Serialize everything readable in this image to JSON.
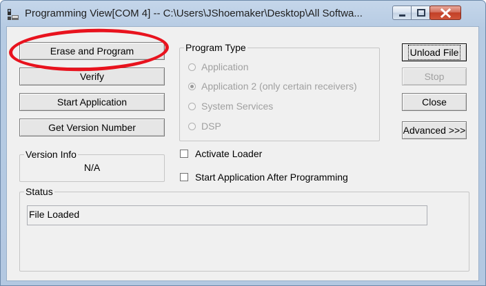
{
  "window": {
    "title": "Programming View[COM 4] -- C:\\Users\\JShoemaker\\Desktop\\All Softwa..."
  },
  "left_buttons": {
    "erase_program": "Erase and Program",
    "verify": "Verify",
    "start_application": "Start Application",
    "get_version": "Get Version Number"
  },
  "program_type": {
    "title": "Program Type",
    "options": [
      "Application",
      "Application 2 (only certain receivers)",
      "System Services",
      "DSP"
    ],
    "selected": "Application 2 (only certain receivers)"
  },
  "right_buttons": {
    "unload_file": "Unload File",
    "stop": "Stop",
    "close": "Close",
    "advanced": "Advanced >>>"
  },
  "version_info": {
    "title": "Version Info",
    "value": "N/A"
  },
  "options": {
    "activate_loader": "Activate Loader",
    "start_after_programming": "Start Application After Programming"
  },
  "status": {
    "title": "Status",
    "value": "File Loaded"
  },
  "colors": {
    "highlight": "#e8131e",
    "titlebar": "#b6cbe3",
    "client_bg": "#f0f0f0"
  }
}
